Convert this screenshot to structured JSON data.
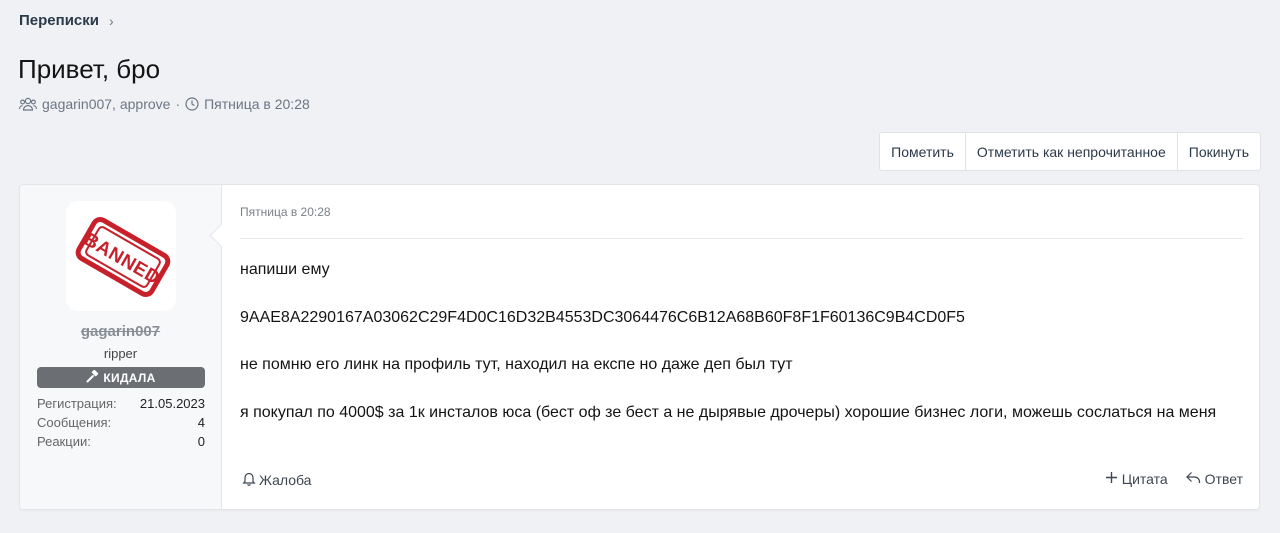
{
  "breadcrumb": {
    "label": "Переписки",
    "chevron": "›"
  },
  "page_title": "Привет, бро",
  "meta": {
    "participants": "gagarin007, approve",
    "separator": "·",
    "date": "Пятница в 20:28"
  },
  "actions": {
    "mark": "Пометить",
    "mark_unread": "Отметить как непрочитанное",
    "leave": "Покинуть"
  },
  "user": {
    "avatar_stamp_text": "BANNED",
    "username": "gagarin007",
    "title": "ripper",
    "banner": "КИДАЛА",
    "stats": [
      {
        "label": "Регистрация:",
        "value": "21.05.2023"
      },
      {
        "label": "Сообщения:",
        "value": "4"
      },
      {
        "label": "Реакции:",
        "value": "0"
      }
    ]
  },
  "message": {
    "date": "Пятница в 20:28",
    "paragraphs": [
      "напиши ему",
      "9AAE8A2290167A03062C29F4D0C16D32B4553DC3064476C6B12A68B60F8F1F60136C9B4CD0F5",
      "не помню его линк на профиль тут, находил на експе но даже деп был тут",
      "я покупал по 4000$ за 1к инсталов юса (бест оф зе бест а не дырявые дрочеры) хорошие бизнес логи, можешь сослаться на меня"
    ],
    "report": "Жалоба",
    "quote": "Цитата",
    "reply": "Ответ"
  },
  "colors": {
    "background": "#f0f1f4",
    "banner_bg": "#6b6e73",
    "stamp_red": "#c8202a"
  },
  "icons": [
    "users-icon",
    "clock-icon",
    "chevron-right-icon",
    "hammer-icon",
    "bell-icon",
    "plus-icon",
    "reply-icon"
  ]
}
